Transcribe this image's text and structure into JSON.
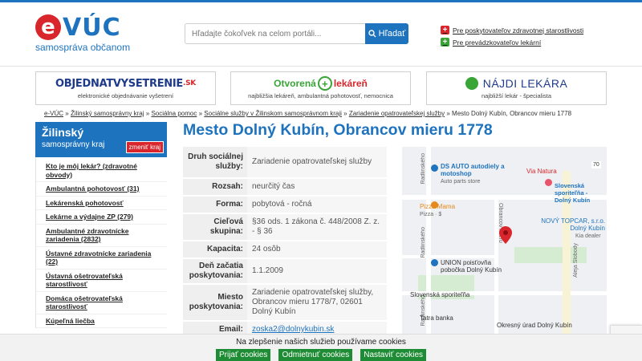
{
  "header": {
    "logo_letter": "e",
    "logo_name": "VÚC",
    "logo_sub": "samospráva občanom",
    "search_placeholder": "Hľadajte čokoľvek na celom portáli...",
    "search_button": "Hľadať",
    "links": [
      {
        "label": "Pre poskytovateľov zdravotnej starostlivosti",
        "icon": "red-cross-icon"
      },
      {
        "label": "Pre prevádzkovateľov lekární",
        "icon": "green-cross-icon"
      }
    ]
  },
  "banners": [
    {
      "title_main": "OBJEDNATVYSETRENIE",
      "title_suffix": ".SK",
      "subtitle": "elektronické objednávanie vyšetrení"
    },
    {
      "title_a": "Otvorená",
      "title_b": "lekáreň",
      "subtitle": "najbližšia lekáreň, ambulantná pohotovosť, nemocnica"
    },
    {
      "title": "NÁJDI LEKÁRA",
      "subtitle": "najbližší lekár - špecialista"
    }
  ],
  "breadcrumb": {
    "items": [
      "e-VÚC",
      "Žilinský samosprávny kraj",
      "Sociálna pomoc",
      "Sociálne služby v Žilinskom samosprávnom kraji",
      "Zariadenie opatrovateľskej služby"
    ],
    "current": "Mesto Dolný Kubín, Obrancov mieru 1778",
    "separator": "»"
  },
  "sidebar": {
    "region_title": "Žilinský",
    "region_sub": "samosprávny kraj",
    "change_label": "zmeniť kraj",
    "items": [
      "Kto je môj lekár? (zdravotné obvody)",
      "Ambulantná pohotovosť (31)",
      "Lekárenská pohotovosť",
      "Lekárne a výdajne ZP (279)",
      "Ambulantné zdravotnícke zariadenia (2832)",
      "Ústavné zdravotnícke zariadenia (22)",
      "Ústavná ošetrovateľská starostlivosť",
      "Domáca ošetrovateľská starostlivosť",
      "Kúpeľná liečba"
    ]
  },
  "main": {
    "title": "Mesto Dolný Kubín, Obrancov mieru 1778",
    "rows": [
      {
        "label": "Druh sociálnej služby:",
        "value": "Zariadenie opatrovateľskej služby"
      },
      {
        "label": "Rozsah:",
        "value": "neurčitý čas"
      },
      {
        "label": "Forma:",
        "value": "pobytová - ročná"
      },
      {
        "label": "Cieľová skupina:",
        "value": "§36 ods. 1 zákona č. 448/2008 Z. z. - § 36"
      },
      {
        "label": "Kapacita:",
        "value": "24 osôb"
      },
      {
        "label": "Deň začatia poskytovania:",
        "value": "1.1.2009"
      },
      {
        "label": "Miesto poskytovania:",
        "value": "Zariadenie opatrovateľskej služby, Obrancov mieru 1778/7, 02601 Dolný Kubín"
      },
      {
        "label": "Email:",
        "value": "zoska2@dolnykubin.sk"
      }
    ]
  },
  "map": {
    "labels": {
      "ds_auto": "DS AUTO autodiely a motoshop",
      "ds_auto_sub": "Auto parts store",
      "via_natura": "Via Natura",
      "sporitelna_dk": "Slovenská sporiteľňa - Dolný Kubín",
      "pizza": "Pizza Mama",
      "pizza_sub": "Pizza · $",
      "topcar": "NOVÝ TOPCAR, s.r.o. Dolný Kubín",
      "topcar_sub": "Kia dealer",
      "union": "UNION poisťovňa pobočka Dolný Kubín",
      "sporitelna": "Slovenská sporiteľňa",
      "tatra": "Tatra banka",
      "urad": "Okresný úrad Dolný Kubín",
      "radlinskeho1": "Radlinského",
      "radlinskeho2": "Radlinského",
      "radlinskeho3": "Radlinského",
      "obrancov": "Obrancov mieru",
      "aleja": "Aleja Slobody",
      "route": "70"
    }
  },
  "cookie": {
    "text": "Na zlepšenie našich služieb používame cookies",
    "accept": "Prijať cookies",
    "reject": "Odmietnuť cookies",
    "settings": "Nastaviť cookies"
  },
  "colors": {
    "brand_blue": "#1e73be",
    "brand_red": "#d9262c",
    "brand_green": "#3aa537",
    "cookie_green": "#1e8c34"
  }
}
